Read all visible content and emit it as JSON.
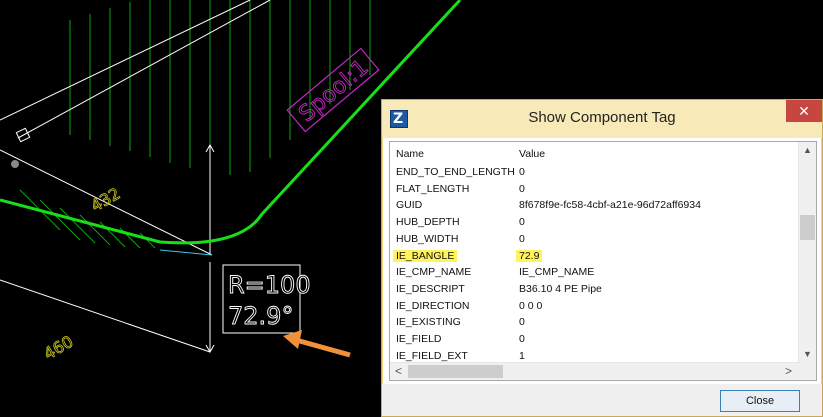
{
  "cad": {
    "spool_label": "Spool:1",
    "dim_upper": "432",
    "dim_lower": "460",
    "radius_line1": "R=100",
    "radius_line2": "72.9°"
  },
  "dialog": {
    "title": "Show Component Tag",
    "close_glyph": "✕",
    "app_icon_glyph": "Z",
    "close_button_label": "Close",
    "columns": {
      "name": "Name",
      "value": "Value"
    },
    "highlight_color": "#fff45c",
    "rows": [
      {
        "name": "END_TO_END_LENGTH",
        "value": "0"
      },
      {
        "name": "FLAT_LENGTH",
        "value": "0"
      },
      {
        "name": "GUID",
        "value": "8f678f9e-fc58-4cbf-a21e-96d72aff6934"
      },
      {
        "name": "HUB_DEPTH",
        "value": "0"
      },
      {
        "name": "HUB_WIDTH",
        "value": "0"
      },
      {
        "name": "IE_BANGLE",
        "value": "72.9"
      },
      {
        "name": "IE_CMP_NAME",
        "value": "IE_CMP_NAME"
      },
      {
        "name": "IE_DESCRIPT",
        "value": "B36.10 4 PE Pipe"
      },
      {
        "name": "IE_DIRECTION",
        "value": "0 0 0"
      },
      {
        "name": "IE_EXISTING",
        "value": "0"
      },
      {
        "name": "IE_FIELD",
        "value": "0"
      },
      {
        "name": "IE_FIELD_EXT",
        "value": "1"
      }
    ],
    "highlighted_row": "IE_BANGLE",
    "arrows": {
      "up": "▲",
      "down": "▼",
      "left": "<",
      "right": ">"
    }
  },
  "colors": {
    "pipe_edge": "#18e018",
    "hatch": "#0fa30f",
    "spool_magenta": "#c427c4",
    "dim_yellow": "#c9c61a",
    "callout_arrow": "#f0913a",
    "leader_cyan": "#38c6e8"
  }
}
